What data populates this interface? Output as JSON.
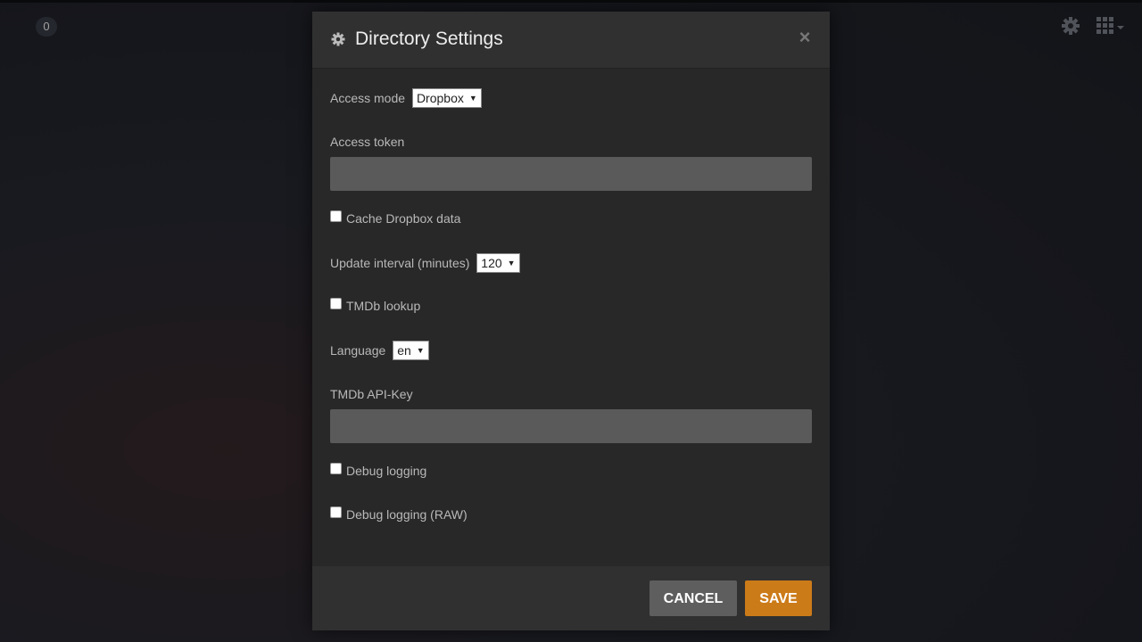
{
  "background": {
    "badge_count": "0",
    "top_icons": [
      "gear-icon",
      "grid-icon"
    ]
  },
  "modal": {
    "title": "Directory Settings",
    "header_icon": "gear-icon",
    "close_icon": "close-icon",
    "close_glyph": "×",
    "fields": {
      "access_mode": {
        "label": "Access mode",
        "value": "Dropbox"
      },
      "access_token": {
        "label": "Access token",
        "value": ""
      },
      "cache_dropbox": {
        "label": "Cache Dropbox data",
        "checked": false
      },
      "update_interval": {
        "label": "Update interval (minutes)",
        "value": "120"
      },
      "tmdb_lookup": {
        "label": "TMDb lookup",
        "checked": false
      },
      "language": {
        "label": "Language",
        "value": "en"
      },
      "tmdb_api_key": {
        "label": "TMDb API-Key",
        "value": ""
      },
      "debug_logging": {
        "label": "Debug logging",
        "checked": false
      },
      "debug_logging_raw": {
        "label": "Debug logging (RAW)",
        "checked": false
      }
    },
    "footer": {
      "cancel_label": "CANCEL",
      "save_label": "SAVE"
    }
  },
  "colors": {
    "accent": "#cc7b19",
    "modal_bg": "#282828",
    "header_bg": "#303030",
    "input_bg": "#5a5a5a",
    "cancel_bg": "#5e5e5e"
  }
}
